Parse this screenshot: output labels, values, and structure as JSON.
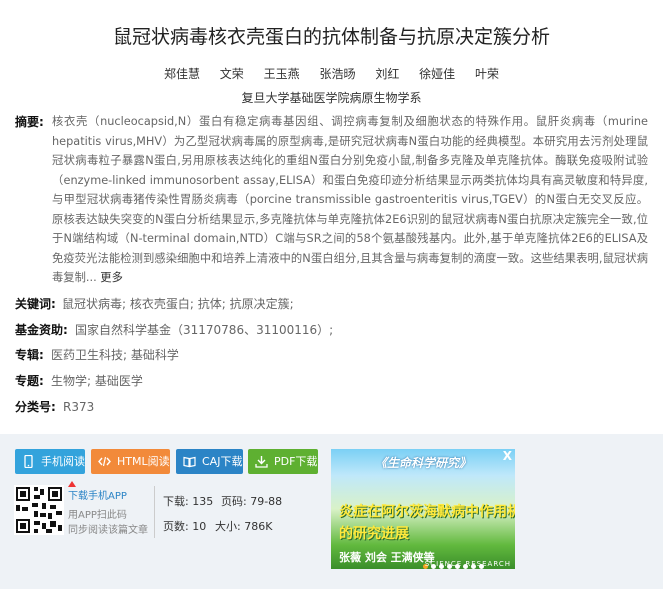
{
  "title": "鼠冠状病毒核衣壳蛋白的抗体制备与抗原决定簇分析",
  "authors": [
    "郑佳慧",
    "文荣",
    "王玉燕",
    "张浩旸",
    "刘红",
    "徐娅佳",
    "叶荣"
  ],
  "organization": "复旦大学基础医学院病原生物学系",
  "abstract": {
    "label": "摘要:",
    "text": "核衣壳（nucleocapsid,N）蛋白有稳定病毒基因组、调控病毒复制及细胞状态的特殊作用。鼠肝炎病毒（murine hepatitis virus,MHV）为乙型冠状病毒属的原型病毒,是研究冠状病毒N蛋白功能的经典模型。本研究用去污剂处理鼠冠状病毒粒子暴露N蛋白,另用原核表达纯化的重组N蛋白分别免疫小鼠,制备多克隆及单克隆抗体。酶联免疫吸附试验（enzyme-linked immunosorbent assay,ELISA）和蛋白免疫印迹分析结果显示两类抗体均具有高灵敏度和特异度,与甲型冠状病毒猪传染性胃肠炎病毒（porcine transmissible gastroenteritis virus,TGEV）的N蛋白无交叉反应。原核表达缺失突变的N蛋白分析结果显示,多克隆抗体与单克隆抗体2E6识别的鼠冠状病毒N蛋白抗原决定簇完全一致,位于N端结构域（N-terminal domain,NTD）C端与SR之间的58个氨基酸残基内。此外,基于单克隆抗体2E6的ELISA及免疫荧光法能检测到感染细胞中和培养上清液中的N蛋白组分,且其含量与病毒复制的滴度一致。这些结果表明,鼠冠状病毒复制...",
    "more": "更多"
  },
  "keywords": {
    "label": "关键词:",
    "value": "鼠冠状病毒;  核衣壳蛋白;  抗体;  抗原决定簇;"
  },
  "fund": {
    "label": "基金资助:",
    "value": "国家自然科学基金（31170786、31100116）;"
  },
  "series": {
    "label": "专辑:",
    "value": "医药卫生科技; 基础科学"
  },
  "topic": {
    "label": "专题:",
    "value": "生物学; 基础医学"
  },
  "class": {
    "label": "分类号:",
    "value": "R373"
  },
  "actions": {
    "mobile": "手机阅读",
    "html": "HTML阅读",
    "caj": "CAJ下载",
    "pdf": "PDF下载"
  },
  "app": {
    "download": "下载手机APP",
    "tip1": "用APP扫此码",
    "tip2": "同步阅读该篇文章"
  },
  "stats": {
    "downloads_label": "下载:",
    "downloads": "135",
    "pages_label": "页码:",
    "pages": "79-88",
    "page_count_label": "页数:",
    "page_count": "10",
    "size_label": "大小:",
    "size": "786K"
  },
  "ad": {
    "header": "《生命科学研究》",
    "line1": "炎症在阿尔茨海默病中作用机制",
    "line2": "的研究进展",
    "authors": "张薇 刘会 王满侠等",
    "footer": "SCIENCE RESEARCH",
    "close": "X"
  }
}
